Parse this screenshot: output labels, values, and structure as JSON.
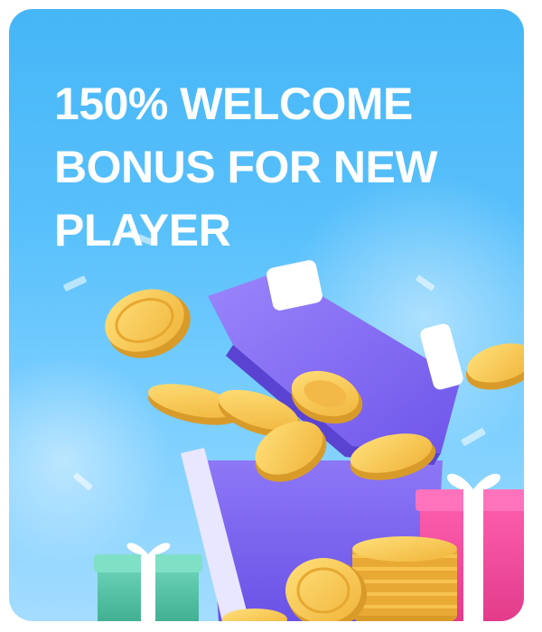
{
  "promo": {
    "headline_lines": [
      "150% WELCOME",
      "BONUS FOR NEW",
      "PLAYER"
    ]
  },
  "icons": {
    "illustration": "gift-box-with-coins-icon",
    "coin": "gold-coin-icon",
    "gift": "gift-box-icon"
  },
  "colors": {
    "background": "#4ab8f8",
    "text": "#ffffff",
    "box_purple": "#7b61f2",
    "coin_gold": "#f6c34a",
    "gift_pink": "#f2459a",
    "gift_teal": "#55c3a6"
  }
}
